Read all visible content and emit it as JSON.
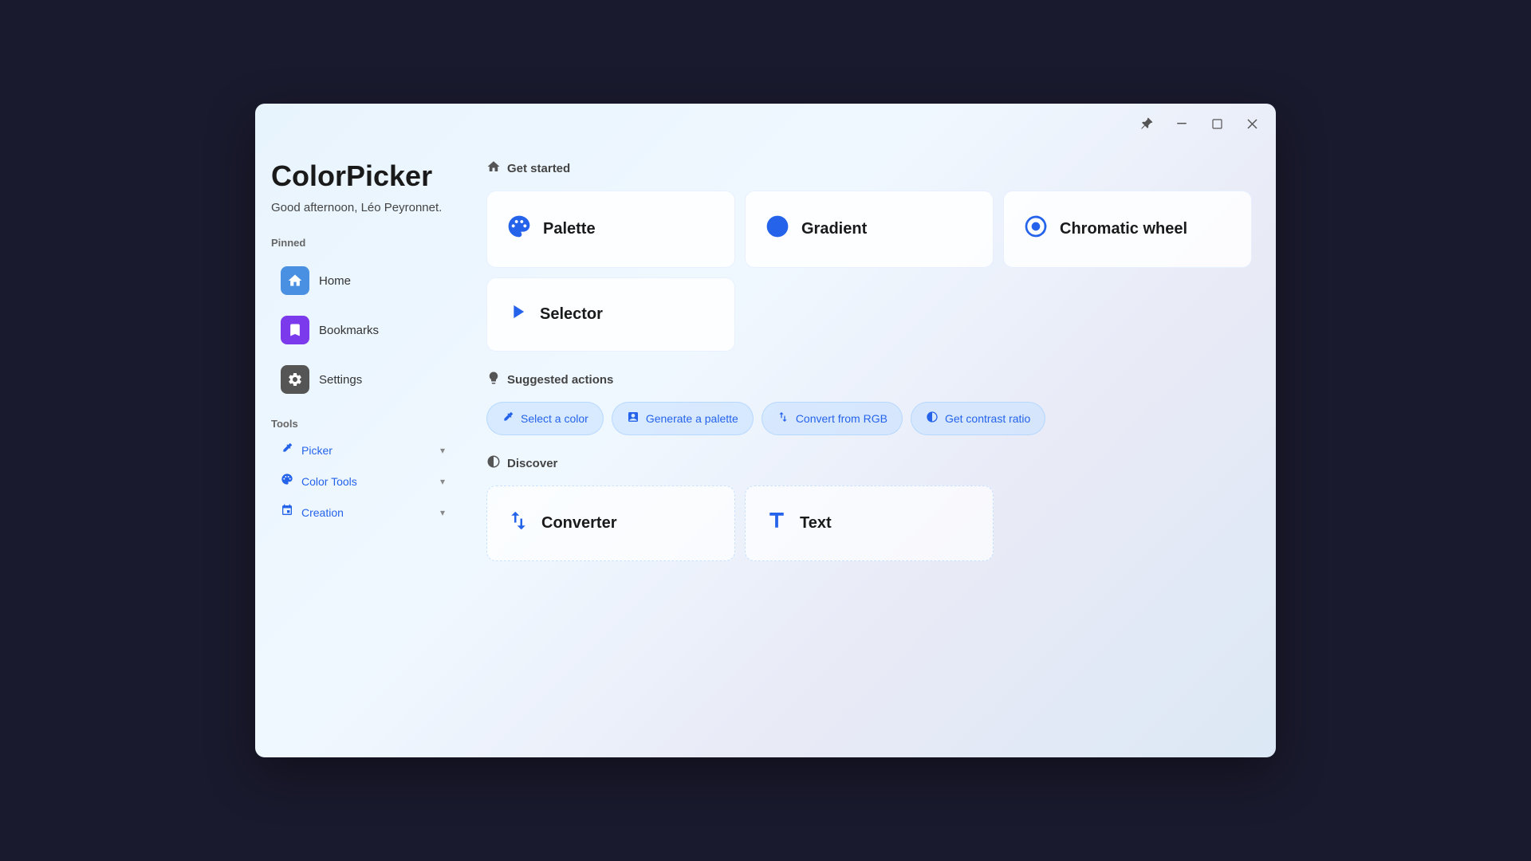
{
  "window": {
    "title": "ColorPicker"
  },
  "titlebar": {
    "pin_icon": "📌",
    "minimize_icon": "—",
    "maximize_icon": "⬜",
    "close_icon": "✕"
  },
  "app": {
    "title": "ColorPicker",
    "greeting": "Good afternoon, Léo Peyronnet."
  },
  "sidebar": {
    "pinned_label": "Pinned",
    "tools_label": "Tools",
    "nav_items": [
      {
        "id": "home",
        "label": "Home",
        "icon": "🏠",
        "style": "home"
      },
      {
        "id": "bookmarks",
        "label": "Bookmarks",
        "icon": "🔖",
        "style": "bookmarks"
      },
      {
        "id": "settings",
        "label": "Settings",
        "icon": "⚙️",
        "style": "settings"
      }
    ],
    "tool_items": [
      {
        "id": "picker",
        "label": "Picker",
        "icon": "✏️"
      },
      {
        "id": "color-tools",
        "label": "Color Tools",
        "icon": "🎨"
      },
      {
        "id": "creation",
        "label": "Creation",
        "icon": "🔗"
      }
    ]
  },
  "main": {
    "get_started": {
      "header": "Get started",
      "header_icon": "🏠",
      "cards": [
        {
          "id": "palette",
          "label": "Palette",
          "icon": "🎨"
        },
        {
          "id": "gradient",
          "label": "Gradient",
          "icon": "💧"
        },
        {
          "id": "chromatic-wheel",
          "label": "Chromatic wheel",
          "icon": "🔄"
        },
        {
          "id": "selector",
          "label": "Selector",
          "icon": "▶️"
        }
      ]
    },
    "suggested_actions": {
      "header": "Suggested actions",
      "header_icon": "💡",
      "chips": [
        {
          "id": "select-color",
          "label": "Select a color",
          "icon": "✏️"
        },
        {
          "id": "generate-palette",
          "label": "Generate a palette",
          "icon": "🎛️"
        },
        {
          "id": "convert-rgb",
          "label": "Convert from RGB",
          "icon": "↕️"
        },
        {
          "id": "contrast-ratio",
          "label": "Get contrast ratio",
          "icon": "🔄"
        }
      ]
    },
    "discover": {
      "header": "Discover",
      "header_icon": "🔄",
      "cards": [
        {
          "id": "converter",
          "label": "Converter",
          "icon": "🔄"
        },
        {
          "id": "text",
          "label": "Text",
          "icon": "T"
        }
      ]
    }
  }
}
